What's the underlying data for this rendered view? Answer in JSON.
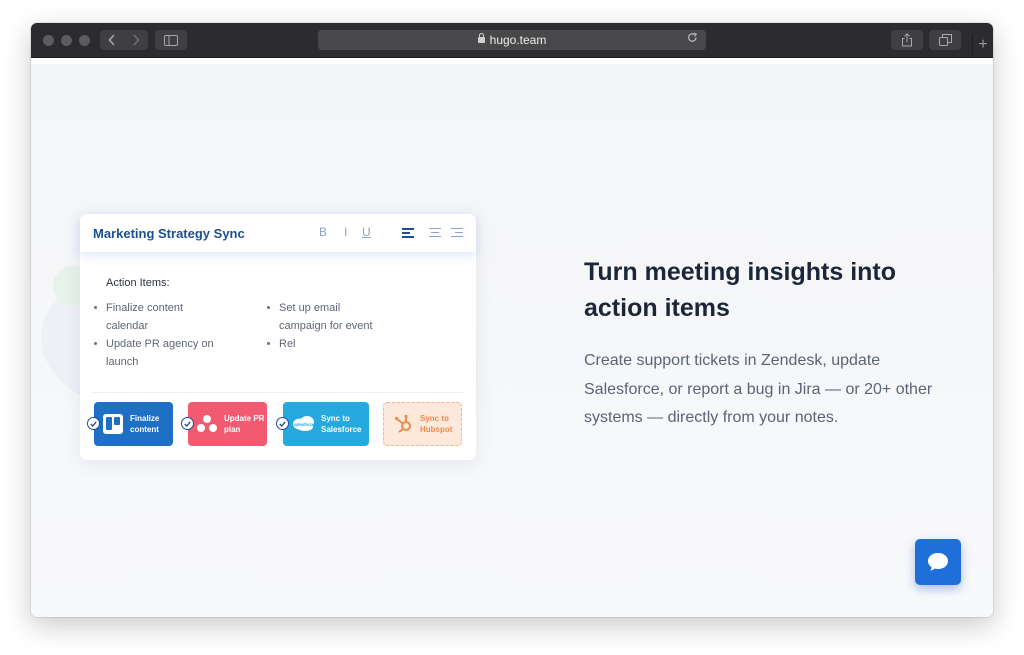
{
  "browser": {
    "url": "hugo.team",
    "new_tab_symbol": "+"
  },
  "card": {
    "title": "Marketing Strategy Sync",
    "format": {
      "bold": "B",
      "italic": "I",
      "underline": "U"
    },
    "action_title": "Action Items:",
    "col1": [
      "Finalize content calendar",
      "Update PR agency on launch"
    ],
    "col2": [
      "Set up email campaign for event",
      "Rel"
    ],
    "chips": [
      {
        "label": "Finalize content",
        "icon": "trello-icon",
        "color": "#1f6fc5",
        "checked": true
      },
      {
        "label": "Update PR plan",
        "icon": "asana-icon",
        "color": "#f25a72",
        "checked": true
      },
      {
        "label": "Sync to Salesforce",
        "icon": "salesforce-icon",
        "icon_text": "salesforce",
        "color": "#25a9df",
        "checked": true
      },
      {
        "label": "Sync to Hubspot",
        "icon": "hubspot-icon",
        "color": "#fde8dc",
        "checked": false
      }
    ]
  },
  "hero": {
    "headline": "Turn meeting insights into action items",
    "description": "Create support tickets in Zendesk, update Salesforce, or report a bug in Jira — or 20+ other systems — directly from your notes."
  },
  "colors": {
    "brand_blue": "#1e4f92",
    "chat_blue": "#1e6fd9",
    "hubspot_orange": "#f08a4b"
  }
}
